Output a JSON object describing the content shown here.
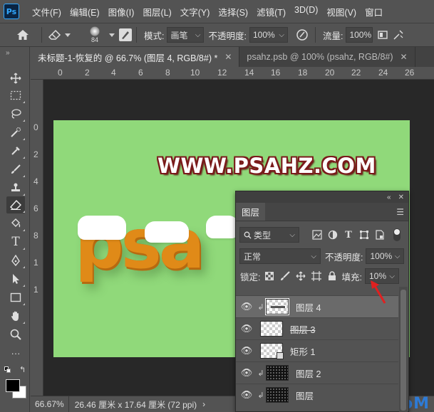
{
  "app": {
    "logo": "Ps"
  },
  "menu": [
    "文件(F)",
    "编辑(E)",
    "图像(I)",
    "图层(L)",
    "文字(Y)",
    "选择(S)",
    "滤镜(T)",
    "3D(D)",
    "视图(V)",
    "窗口"
  ],
  "options": {
    "home_icon": "home-icon",
    "tool_icon": "eraser-icon",
    "brush_size": "84",
    "mode_label": "模式:",
    "mode_value": "画笔",
    "opacity_label": "不透明度:",
    "opacity_value": "100%",
    "flow_label": "流量:",
    "flow_value": "100%"
  },
  "tabs": [
    {
      "label": "未标题-1-恢复的 @ 66.7% (图层 4, RGB/8#) *",
      "active": true
    },
    {
      "label": "psahz.psb @ 100% (psahz, RGB/8#)",
      "active": false
    }
  ],
  "ruler": {
    "top": [
      "0",
      "2",
      "4",
      "6",
      "8",
      "10",
      "12",
      "14",
      "16",
      "18",
      "20",
      "22",
      "24",
      "26"
    ],
    "left": [
      "0",
      "2",
      "4",
      "6",
      "8",
      "1",
      "1"
    ]
  },
  "canvas": {
    "watermark_text": "WWW.PSAHZ.COM",
    "beer_text": "psa",
    "background_color": "#90d97a"
  },
  "status": {
    "zoom": "66.67%",
    "doc_info": "26.46 厘米 x 17.64 厘米 (72 ppi)",
    "nav_arrow": "›"
  },
  "site_watermark": "UiBQ.CoM",
  "layers_panel": {
    "title": "图层",
    "filter_label": "类型",
    "blend_mode": "正常",
    "opacity_label": "不透明度:",
    "opacity_value": "100%",
    "lock_label": "锁定:",
    "fill_label": "填充:",
    "fill_value": "10%",
    "layers": [
      {
        "name": "图层 4",
        "clipped": true,
        "selected": true,
        "visible": true
      },
      {
        "name": "图层 3",
        "clipped": false,
        "selected": false,
        "visible": true,
        "strike": true
      },
      {
        "name": "矩形 1",
        "clipped": false,
        "selected": false,
        "visible": true
      },
      {
        "name": "图层 2",
        "clipped": true,
        "selected": false,
        "visible": true
      },
      {
        "name": "图层",
        "clipped": true,
        "selected": false,
        "visible": true
      }
    ]
  },
  "colors": {
    "accent": "#31a8ff",
    "annotation": "#e02020"
  }
}
